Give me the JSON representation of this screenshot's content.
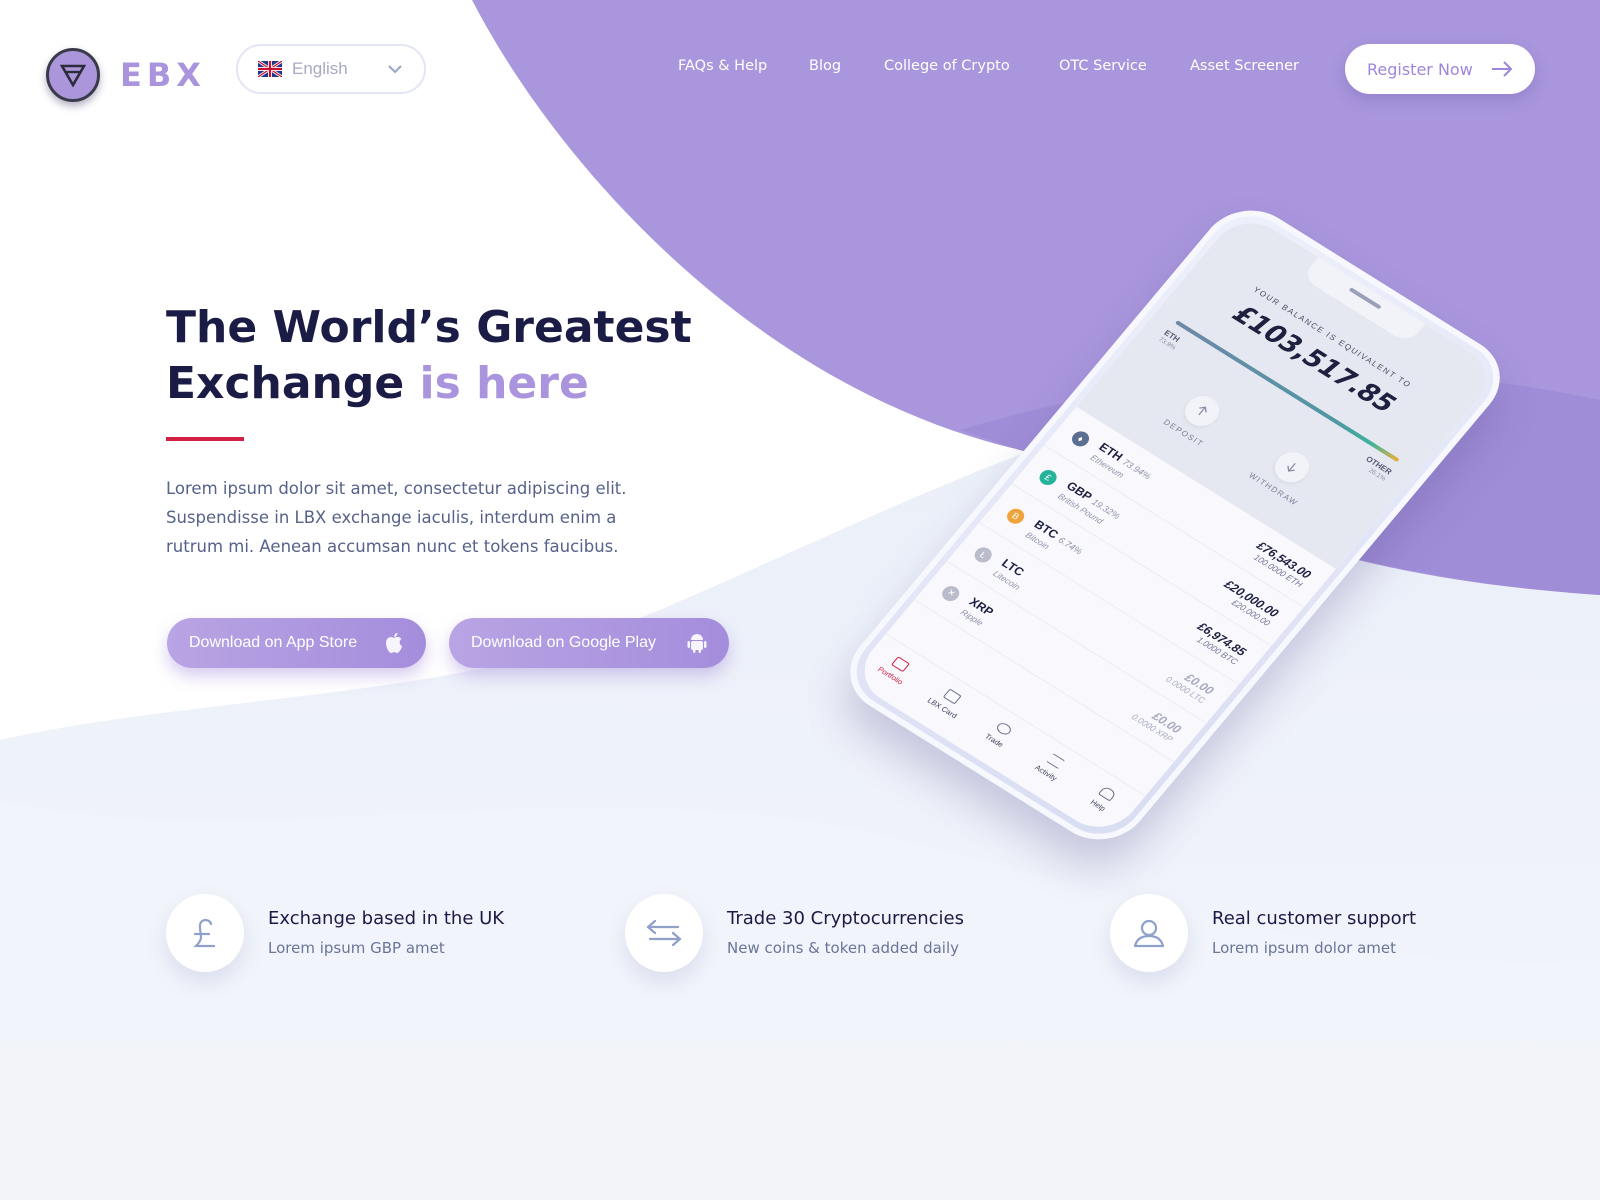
{
  "brand": {
    "name": "EBX"
  },
  "language": {
    "selected": "English"
  },
  "nav": {
    "items": [
      "FAQs & Help",
      "Blog",
      "College of Crypto",
      "OTC Service",
      "Asset Screener"
    ],
    "register_label": "Register Now"
  },
  "hero": {
    "title_line1": "The World’s Greatest",
    "title_line2_main": "Exchange ",
    "title_line2_accent": "is here",
    "description": "Lorem ipsum dolor sit amet, consectetur adipiscing elit. Suspendisse in LBX exchange iaculis, interdum enim a rutrum mi. Aenean accumsan nunc et tokens faucibus.",
    "app_store_label": "Download on App Store",
    "google_play_label": "Download on Google Play"
  },
  "phone": {
    "balance_label": "YOUR BALANCE IS EQUIVALENT TO",
    "balance_value": "£103,517.85",
    "bar_left_label": "ETH",
    "bar_left_pct": "73.9%",
    "bar_right_label": "OTHER",
    "bar_right_pct": "26.1%",
    "deposit_label": "DEPOSIT",
    "withdraw_label": "WITHDRAW",
    "coins": [
      {
        "symbol": "ETH",
        "pct": "73.94%",
        "name": "Ethereum",
        "value": "£76,543.00",
        "qty": "100.0000 ETH",
        "color": "#5b6f93",
        "glyph": "♦"
      },
      {
        "symbol": "GBP",
        "pct": "19.32%",
        "name": "British Pound",
        "value": "£20,000.00",
        "qty": "£20,000.00",
        "color": "#27b39b",
        "glyph": "£"
      },
      {
        "symbol": "BTC",
        "pct": "6.74%",
        "name": "Bitcoin",
        "value": "£6,974.85",
        "qty": "1.0000 BTC",
        "color": "#f0a33a",
        "glyph": "B"
      },
      {
        "symbol": "LTC",
        "pct": "",
        "name": "Litecoin",
        "value": "£0.00",
        "qty": "0.0000 LTC",
        "color": "#b9bccb",
        "glyph": "Ł"
      },
      {
        "symbol": "XRP",
        "pct": "",
        "name": "Ripple",
        "value": "£0.00",
        "qty": "0.0000 XRP",
        "color": "#b9bccb",
        "glyph": "✕"
      }
    ],
    "tabs": [
      "Portfolio",
      "LBX Card",
      "Trade",
      "Activity",
      "Help"
    ]
  },
  "features": [
    {
      "title": "Exchange based in the UK",
      "subtitle": "Lorem ipsum GBP amet",
      "icon": "pound-icon"
    },
    {
      "title": "Trade 30 Cryptocurrencies",
      "subtitle": "New coins & token added daily",
      "icon": "exchange-arrows-icon"
    },
    {
      "title": "Real customer support",
      "subtitle": "Lorem ipsum dolor amet",
      "icon": "user-icon"
    }
  ],
  "colors": {
    "accent": "#a994dd",
    "purple_bg": "#a996dc",
    "red": "#d21f44",
    "dark": "#1b1c45"
  }
}
